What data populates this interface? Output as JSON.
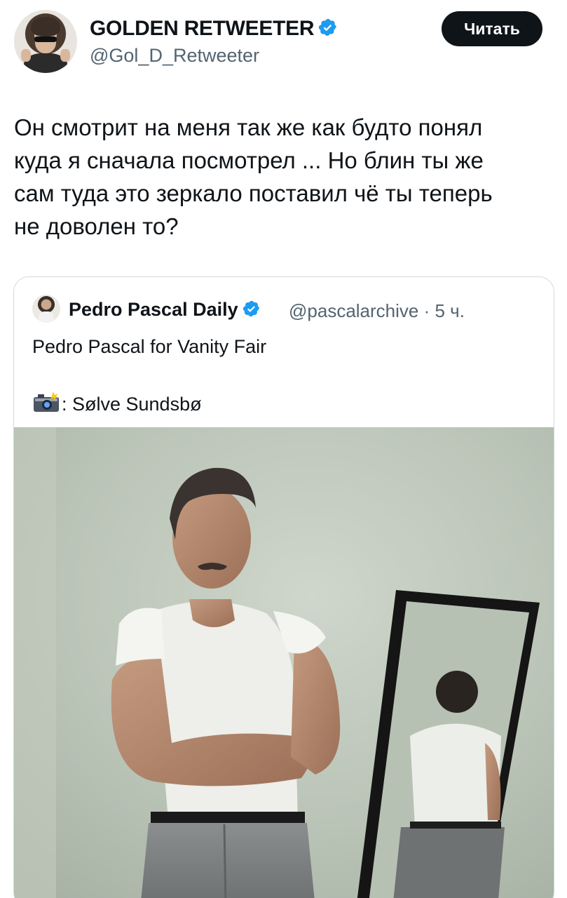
{
  "author": {
    "name": "GOLDEN RETWEETER",
    "handle": "@Gol_D_Retweeter",
    "verified": true
  },
  "follow_button": {
    "label": "Читать"
  },
  "tweet": {
    "lines": [
      "Он смотрит на меня так же как будто понял",
      "куда я сначала посмотрел ... Но блин ты же",
      "сам туда это зеркало поставил чё ты теперь",
      "не доволен то?"
    ]
  },
  "quoted": {
    "name": "Pedro Pascal Daily",
    "verified": true,
    "meta": "@pascalarchive · 5 ч.",
    "text_line1": "Pedro Pascal for Vanity Fair",
    "camera_icon": "camera-flash-icon",
    "credit": ": Sølve Sundsbø"
  },
  "colors": {
    "text": "#0f1419",
    "secondary": "#536471",
    "verified": "#1d9bf0",
    "border": "#cfd9de"
  }
}
